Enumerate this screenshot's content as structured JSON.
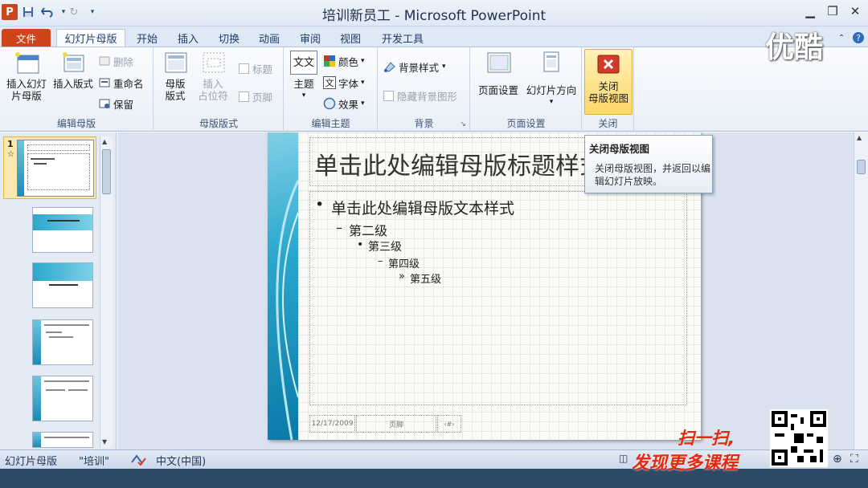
{
  "titlebar": {
    "title": "培训新员工 - Microsoft PowerPoint",
    "app_icon_letter": "P"
  },
  "tabs": [
    {
      "label": "文件"
    },
    {
      "label": "幻灯片母版"
    },
    {
      "label": "开始"
    },
    {
      "label": "插入"
    },
    {
      "label": "切换"
    },
    {
      "label": "动画"
    },
    {
      "label": "审阅"
    },
    {
      "label": "视图"
    },
    {
      "label": "开发工具"
    }
  ],
  "ribbon": {
    "edit_master": {
      "label": "编辑母版",
      "insert_master_line1": "插入幻灯",
      "insert_master_line2": "片母版",
      "insert_layout": "插入版式",
      "delete": "删除",
      "rename": "重命名",
      "preserve": "保留"
    },
    "master_layout": {
      "label": "母版版式",
      "master_layout_line1": "母版",
      "master_layout_line2": "版式",
      "insert_placeholder_line1": "插入",
      "insert_placeholder_line2": "占位符",
      "title": "标题",
      "footer": "页脚"
    },
    "edit_theme": {
      "label": "编辑主题",
      "themes": "主题",
      "colors": "颜色",
      "fonts": "字体",
      "effects": "效果",
      "font_icon_text": "文文",
      "font_icon_text2": "文"
    },
    "background": {
      "label": "背景",
      "background_styles": "背景样式",
      "hide_background": "隐藏背景图形"
    },
    "page_setup": {
      "label": "页面设置",
      "page_setup": "页面设置",
      "orientation": "幻灯片方向"
    },
    "close": {
      "label": "关闭",
      "close_line1": "关闭",
      "close_line2": "母版视图"
    }
  },
  "thumbnails": {
    "first_number": "1",
    "first_star": "☆"
  },
  "slide": {
    "title": "单击此处编辑母版标题样式",
    "levels": [
      "单击此处编辑母版文本样式",
      "第二级",
      "第三级",
      "第四级",
      "第五级"
    ],
    "bullets": [
      "•",
      "–",
      "•",
      "–",
      "»"
    ],
    "footer_date": "12/17/2009",
    "footer_text": "页脚",
    "footer_number": "‹#›"
  },
  "tooltip": {
    "title": "关闭母版视图",
    "body": "关闭母版视图，并返回以编辑幻灯片放映。"
  },
  "statusbar": {
    "view": "幻灯片母版",
    "theme": "\"培训\"",
    "language": "中文(中国)"
  },
  "watermark": {
    "brand": "优酷",
    "scan": "扫一扫,",
    "more": "发现更多课程"
  },
  "colors": {
    "file_tab": "#d0441c",
    "accent": "#1b8cb5"
  }
}
